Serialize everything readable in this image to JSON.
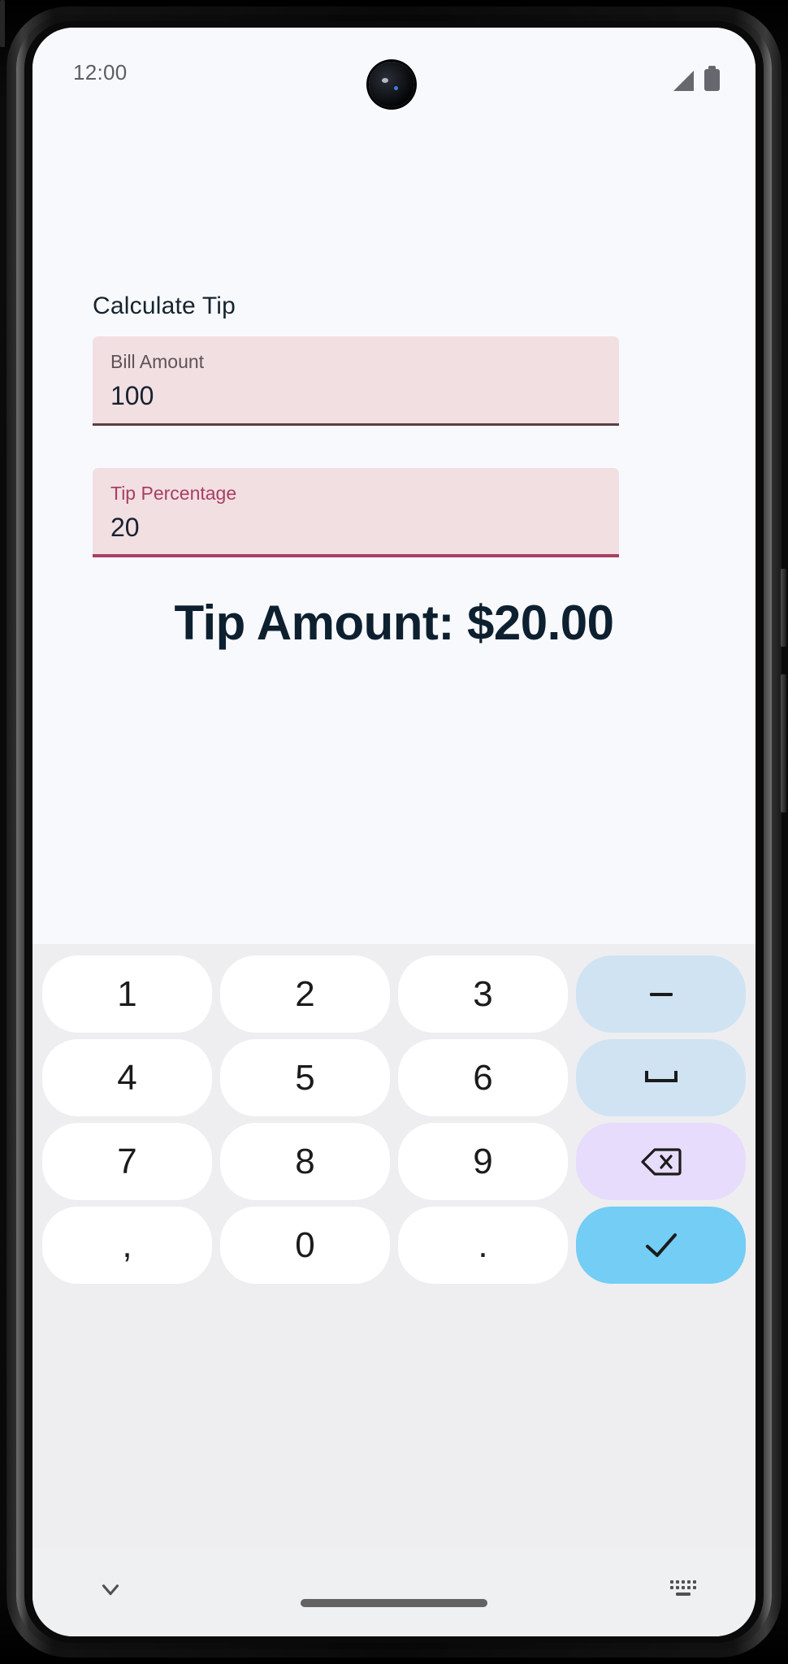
{
  "device": {
    "status_bar": {
      "time": "12:00",
      "signal_icon": "signal-bars-icon",
      "battery_icon": "battery-full-icon",
      "camera_icon": "front-camera-punch-hole"
    },
    "side_buttons": {
      "power": "power-button",
      "volume": "volume-button"
    },
    "nav_bar": {
      "hide_keyboard_icon": "chevron-down-icon",
      "switch_keyboard_icon": "keyboard-switch-icon",
      "home_indicator": "home-indicator"
    }
  },
  "app": {
    "title": "Calculate Tip",
    "fields": [
      {
        "name": "bill-amount",
        "label": "Bill Amount",
        "value": "100",
        "placeholder": "Bill Amount",
        "focused": false,
        "underline_color": "#5a4145",
        "label_color": "#5f5257",
        "background": "#f2dfe2"
      },
      {
        "name": "tip-percentage",
        "label": "Tip Percentage",
        "value": "20",
        "placeholder": "Tip Percentage",
        "focused": true,
        "underline_color": "#a83f63",
        "label_color": "#a83f63",
        "background": "#f2dfe2"
      }
    ],
    "result": "Tip Amount: $20.00",
    "colors": {
      "screen_background": "#f8f9fd",
      "title_text": "#16242e",
      "result_text": "#0d2030",
      "field_fill": "#f2dfe2",
      "accent_focus": "#a83f63"
    }
  },
  "keyboard": {
    "background": "#eeeef0",
    "keys": [
      {
        "name": "key-1",
        "label": "1",
        "type": "digit",
        "style": "white"
      },
      {
        "name": "key-2",
        "label": "2",
        "type": "digit",
        "style": "white"
      },
      {
        "name": "key-3",
        "label": "3",
        "type": "digit",
        "style": "white"
      },
      {
        "name": "key-minus",
        "label": "−",
        "type": "function",
        "style": "blue",
        "icon": "minus-icon"
      },
      {
        "name": "key-4",
        "label": "4",
        "type": "digit",
        "style": "white"
      },
      {
        "name": "key-5",
        "label": "5",
        "type": "digit",
        "style": "white"
      },
      {
        "name": "key-6",
        "label": "6",
        "type": "digit",
        "style": "white"
      },
      {
        "name": "key-space",
        "label": "",
        "type": "function",
        "style": "blue",
        "icon": "space-bar-icon"
      },
      {
        "name": "key-7",
        "label": "7",
        "type": "digit",
        "style": "white"
      },
      {
        "name": "key-8",
        "label": "8",
        "type": "digit",
        "style": "white"
      },
      {
        "name": "key-9",
        "label": "9",
        "type": "digit",
        "style": "white"
      },
      {
        "name": "key-backspace",
        "label": "",
        "type": "function",
        "style": "purple",
        "icon": "backspace-icon"
      },
      {
        "name": "key-comma",
        "label": ",",
        "type": "punct",
        "style": "white"
      },
      {
        "name": "key-0",
        "label": "0",
        "type": "digit",
        "style": "white"
      },
      {
        "name": "key-period",
        "label": ".",
        "type": "punct",
        "style": "white"
      },
      {
        "name": "key-enter",
        "label": "",
        "type": "function",
        "style": "enter",
        "icon": "check-icon"
      }
    ],
    "key_colors": {
      "white": "#ffffff",
      "blue": "#cfe3f3",
      "purple": "#e7dcfb",
      "enter": "#73cdf5"
    }
  }
}
